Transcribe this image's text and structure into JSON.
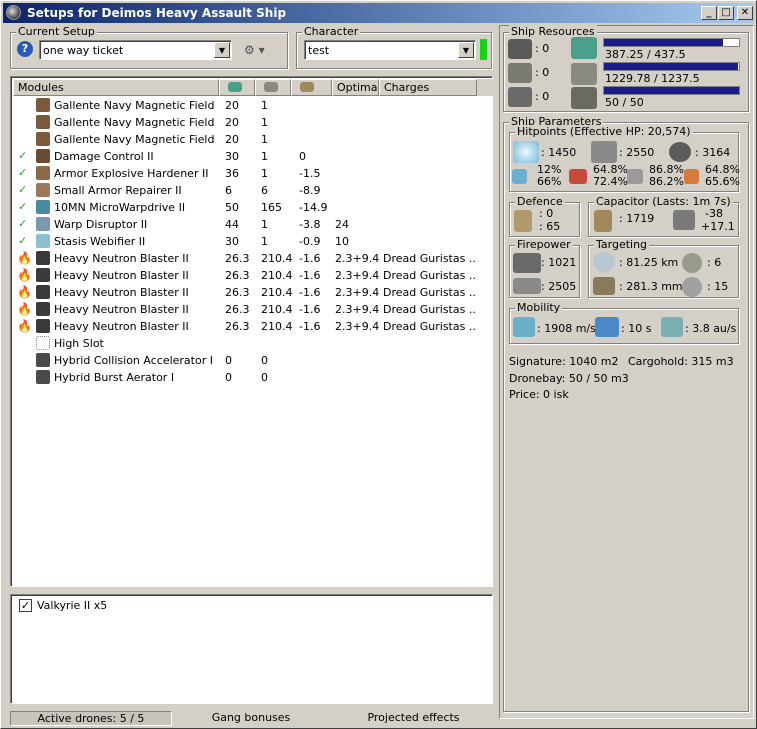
{
  "window": {
    "title": "Setups for Deimos Heavy Assault Ship"
  },
  "current_setup": {
    "legend": "Current Setup",
    "value": "one way ticket"
  },
  "character": {
    "legend": "Character",
    "value": "test"
  },
  "modules": {
    "headers": {
      "name": "Modules",
      "optimal": "Optimal",
      "charges": "Charges"
    },
    "rows": [
      {
        "name": "Gallente Navy Magnetic Field St...",
        "cpu": "20",
        "pg": "1",
        "cap": "",
        "optimal": "",
        "charges": "",
        "status": "none",
        "icon": "#7a5a3a"
      },
      {
        "name": "Gallente Navy Magnetic Field St...",
        "cpu": "20",
        "pg": "1",
        "cap": "",
        "optimal": "",
        "charges": "",
        "status": "none",
        "icon": "#7a5a3a"
      },
      {
        "name": "Gallente Navy Magnetic Field St...",
        "cpu": "20",
        "pg": "1",
        "cap": "",
        "optimal": "",
        "charges": "",
        "status": "none",
        "icon": "#7a5a3a"
      },
      {
        "name": "Damage Control II",
        "cpu": "30",
        "pg": "1",
        "cap": "0",
        "optimal": "",
        "charges": "",
        "status": "check",
        "icon": "#6a4a30"
      },
      {
        "name": "Armor Explosive Hardener II",
        "cpu": "36",
        "pg": "1",
        "cap": "-1.5",
        "optimal": "",
        "charges": "",
        "status": "check",
        "icon": "#8a6a4a"
      },
      {
        "name": "Small Armor Repairer II",
        "cpu": "6",
        "pg": "6",
        "cap": "-8.9",
        "optimal": "",
        "charges": "",
        "status": "check",
        "icon": "#9a7a5a"
      },
      {
        "name": "10MN MicroWarpdrive II",
        "cpu": "50",
        "pg": "165",
        "cap": "-14.9",
        "optimal": "",
        "charges": "",
        "status": "check",
        "icon": "#4a8aa0"
      },
      {
        "name": "Warp Disruptor II",
        "cpu": "44",
        "pg": "1",
        "cap": "-3.8",
        "optimal": "24",
        "charges": "",
        "status": "check",
        "icon": "#7a9ab0"
      },
      {
        "name": "Stasis Webifier II",
        "cpu": "30",
        "pg": "1",
        "cap": "-0.9",
        "optimal": "10",
        "charges": "",
        "status": "check",
        "icon": "#8ac0d0"
      },
      {
        "name": "Heavy Neutron Blaster II",
        "cpu": "26.3",
        "pg": "210.4",
        "cap": "-1.6",
        "optimal": "2.3+9.4",
        "charges": "Dread Guristas ...",
        "status": "fire",
        "icon": "#3a3a3a"
      },
      {
        "name": "Heavy Neutron Blaster II",
        "cpu": "26.3",
        "pg": "210.4",
        "cap": "-1.6",
        "optimal": "2.3+9.4",
        "charges": "Dread Guristas ...",
        "status": "fire",
        "icon": "#3a3a3a"
      },
      {
        "name": "Heavy Neutron Blaster II",
        "cpu": "26.3",
        "pg": "210.4",
        "cap": "-1.6",
        "optimal": "2.3+9.4",
        "charges": "Dread Guristas ...",
        "status": "fire",
        "icon": "#3a3a3a"
      },
      {
        "name": "Heavy Neutron Blaster II",
        "cpu": "26.3",
        "pg": "210.4",
        "cap": "-1.6",
        "optimal": "2.3+9.4",
        "charges": "Dread Guristas ...",
        "status": "fire",
        "icon": "#3a3a3a"
      },
      {
        "name": "Heavy Neutron Blaster II",
        "cpu": "26.3",
        "pg": "210.4",
        "cap": "-1.6",
        "optimal": "2.3+9.4",
        "charges": "Dread Guristas ...",
        "status": "fire",
        "icon": "#3a3a3a"
      },
      {
        "name": "High Slot",
        "cpu": "",
        "pg": "",
        "cap": "",
        "optimal": "",
        "charges": "",
        "status": "none",
        "icon": "slot"
      },
      {
        "name": "Hybrid Collision Accelerator I",
        "cpu": "0",
        "pg": "0",
        "cap": "",
        "optimal": "",
        "charges": "",
        "status": "none",
        "icon": "#4a4a4a"
      },
      {
        "name": "Hybrid Burst Aerator I",
        "cpu": "0",
        "pg": "0",
        "cap": "",
        "optimal": "",
        "charges": "",
        "status": "none",
        "icon": "#4a4a4a"
      }
    ]
  },
  "drones": {
    "items": [
      {
        "label": "Valkyrie II x5",
        "checked": true
      }
    ]
  },
  "status_bar": {
    "active_drones": "Active drones: 5 / 5",
    "gang": "Gang bonuses",
    "projected": "Projected effects"
  },
  "resources": {
    "legend": "Ship Resources",
    "turret": ": 0",
    "launcher": ": 0",
    "drone": ": 0",
    "cpu_text": "387.25 / 437.5",
    "cpu_fraction": 0.885,
    "pg_text": "1229.78 / 1237.5",
    "pg_fraction": 0.994,
    "dronebw_text": "50 / 50",
    "dronebw_fraction": 1.0
  },
  "params": {
    "legend": "Ship Parameters",
    "hitpoints_legend": "Hitpoints (Effective HP: 20,574)",
    "shield_hp": ": 1450",
    "armor_hp": ": 2550",
    "structure_hp": ": 3164",
    "res_shield": "12%\n66%",
    "res_armor": "64.8%\n72.4%",
    "res_structure": "86.8%\n86.2%",
    "res_extra": "64.8%\n65.6%",
    "defence_legend": "Defence",
    "defence_a": ": 0",
    "defence_b": ": 65",
    "capacitor_legend": "Capacitor (Lasts: 1m 7s)",
    "capacitor_amount": ": 1719",
    "capacitor_delta_a": "-38",
    "capacitor_delta_b": "+17.1",
    "firepower_legend": "Firepower",
    "firepower_a": ": 1021",
    "firepower_b": ": 2505",
    "targeting_legend": "Targeting",
    "target_range": ": 81.25 km",
    "max_targets": ": 6",
    "scan_res": ": 281.3 mm",
    "sensor_strength": ": 15",
    "mobility_legend": "Mobility",
    "velocity": ": 1908 m/s",
    "align": ": 10 s",
    "warp": ": 3.8 au/s",
    "signature": "Signature: 1040 m2",
    "cargohold": "Cargohold: 315 m3",
    "dronebay": "Dronebay: 50 / 50 m3",
    "price": "Price: 0 isk"
  },
  "colors": {
    "titlebar": "#0a246a",
    "bar_fill": "#1c1c8c",
    "check": "#2e9b2e",
    "fire": "#c8331e"
  }
}
